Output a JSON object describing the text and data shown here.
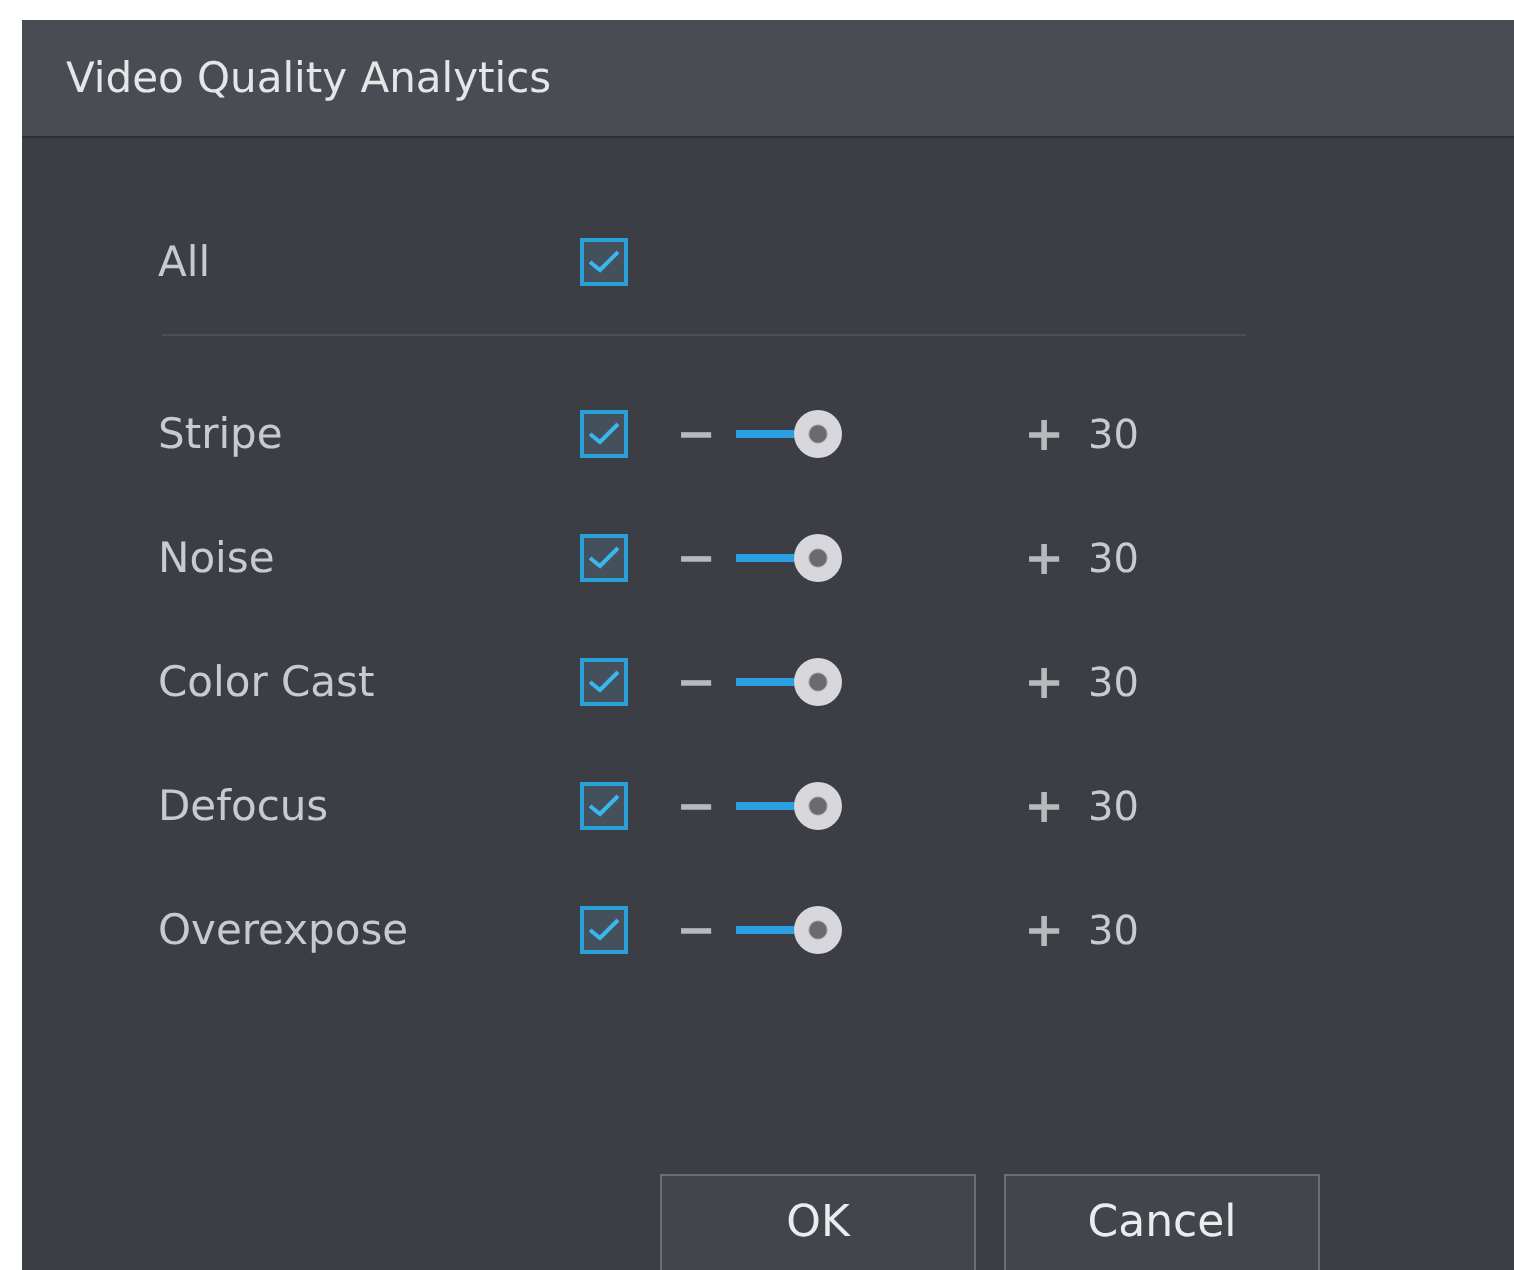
{
  "window": {
    "title": "Video Quality Analytics"
  },
  "all": {
    "label": "All",
    "checked": true
  },
  "items": [
    {
      "label": "Stripe",
      "checked": true,
      "level": 0.3,
      "minus": "−",
      "plus": "+",
      "value": "30"
    },
    {
      "label": "Noise",
      "checked": true,
      "level": 0.3,
      "minus": "−",
      "plus": "+",
      "value": "30"
    },
    {
      "label": "Color Cast",
      "checked": true,
      "level": 0.3,
      "minus": "−",
      "plus": "+",
      "value": "30"
    },
    {
      "label": "Defocus",
      "checked": true,
      "level": 0.3,
      "minus": "−",
      "plus": "+",
      "value": "30"
    },
    {
      "label": "Overexpose",
      "checked": true,
      "level": 0.3,
      "minus": "−",
      "plus": "+",
      "value": "30"
    }
  ],
  "buttons": [
    "OK",
    "Cancel"
  ]
}
